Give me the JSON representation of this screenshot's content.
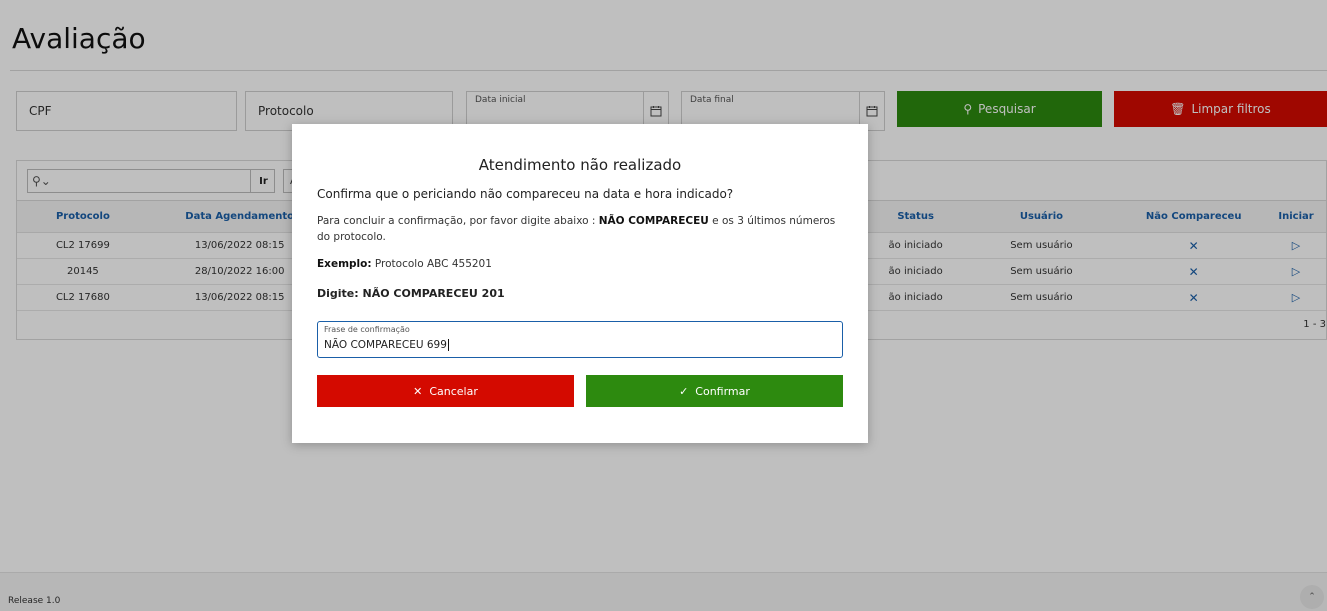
{
  "page": {
    "title": "Avaliação"
  },
  "filters": {
    "cpf_placeholder": "CPF",
    "protocolo_placeholder": "Protocolo",
    "data_inicial_label": "Data inicial",
    "data_final_label": "Data final",
    "search_label": "Pesquisar",
    "clear_label": "Limpar filtros",
    "search_color": "#2d8a0f",
    "clear_color": "#d40a00"
  },
  "toolbar": {
    "go_label": "Ir",
    "actions_label": "Açõ"
  },
  "grid": {
    "columns": {
      "protocolo": "Protocolo",
      "data_agendamento": "Data Agendamento",
      "status": "Status",
      "usuario": "Usuário",
      "nao_compareceu": "Não Compareceu",
      "iniciar": "Iniciar"
    },
    "rows": [
      {
        "protocolo": "CL2 17699",
        "data": "13/06/2022 08:15",
        "status": "ão iniciado",
        "usuario": "Sem usuário"
      },
      {
        "protocolo": "20145",
        "data": "28/10/2022 16:00",
        "status": "ão iniciado",
        "usuario": "Sem usuário"
      },
      {
        "protocolo": "CL2 17680",
        "data": "13/06/2022 08:15",
        "status": "ão iniciado",
        "usuario": "Sem usuário"
      }
    ],
    "pagination": "1 - 3"
  },
  "footer": {
    "release": "Release 1.0"
  },
  "modal": {
    "title": "Atendimento não realizado",
    "question": "Confirma que o periciando não compareceu na data e hora indicado?",
    "instruction_pre": "Para concluir a confirmação, por favor digite abaixo : ",
    "instruction_bold": "NÃO COMPARECEU",
    "instruction_post": " e os 3 últimos números do protocolo.",
    "example_label": "Exemplo:",
    "example_value": " Protocolo ABC 455201",
    "digite": "Digite: NÃO COMPARECEU 201",
    "input_label": "Frase de confirmação",
    "input_value": "NÃO COMPARECEU 699",
    "cancel_label": "Cancelar",
    "confirm_label": "Confirmar"
  },
  "icons": {
    "search": "search-icon",
    "trash": "trash-icon",
    "calendar": "calendar-icon",
    "close": "close-icon",
    "check": "check-icon",
    "play": "play-icon",
    "chevron_up": "chevron-up-icon"
  }
}
